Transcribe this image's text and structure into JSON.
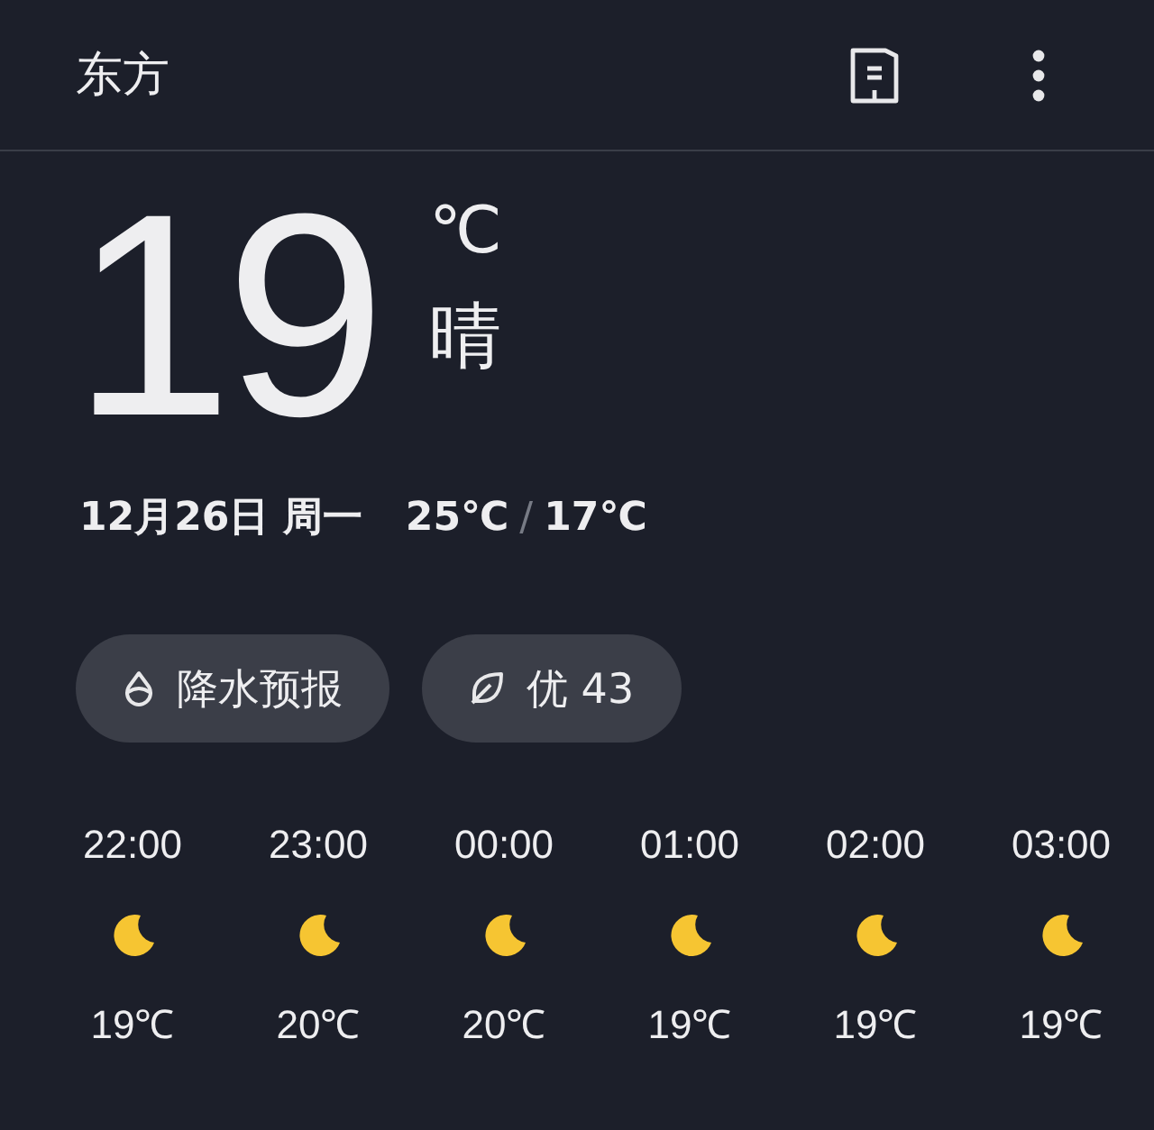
{
  "header": {
    "title": "东方"
  },
  "current": {
    "temperature": "19",
    "unit": "℃",
    "condition": "晴"
  },
  "summary": {
    "date": "12月26日 周一",
    "high": "25℃",
    "separator": "/",
    "low": "17℃"
  },
  "chips": [
    {
      "kind": "rain",
      "label": "降水预报"
    },
    {
      "kind": "air",
      "label": "优 43"
    }
  ],
  "hourly": [
    {
      "time": "22:00",
      "temp": "19℃"
    },
    {
      "time": "23:00",
      "temp": "20℃"
    },
    {
      "time": "00:00",
      "temp": "20℃"
    },
    {
      "time": "01:00",
      "temp": "19℃"
    },
    {
      "time": "02:00",
      "temp": "19℃"
    },
    {
      "time": "03:00",
      "temp": "19℃"
    }
  ]
}
